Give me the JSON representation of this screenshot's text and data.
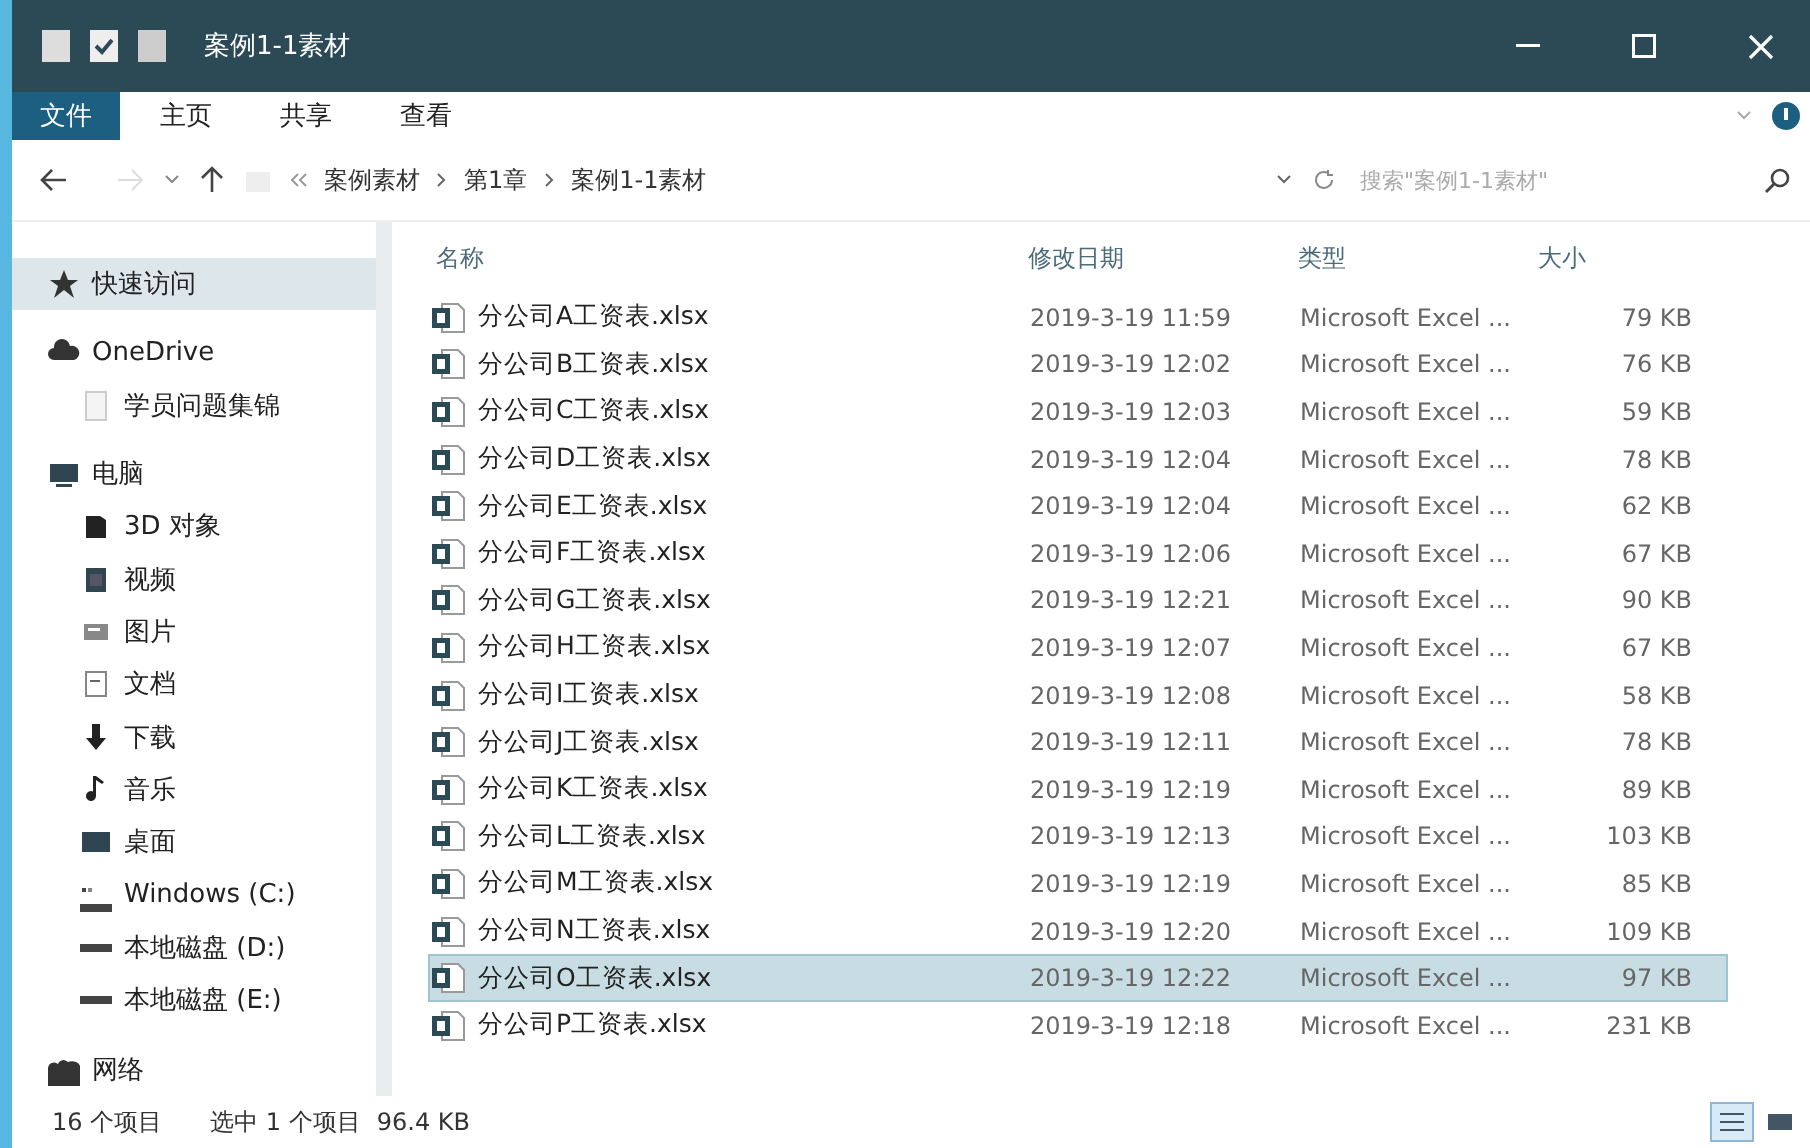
{
  "window": {
    "title": "案例1-1素材"
  },
  "ribbon_tabs": [
    {
      "label": "文件",
      "kind": "file"
    },
    {
      "label": "主页",
      "kind": "tab"
    },
    {
      "label": "共享",
      "kind": "tab"
    },
    {
      "label": "查看",
      "kind": "tab"
    }
  ],
  "breadcrumb": [
    "案例素材",
    "第1章",
    "案例1-1素材"
  ],
  "search": {
    "placeholder": "搜索\"案例1-1素材\""
  },
  "sidebar": {
    "items": [
      {
        "label": "快速访问",
        "selected": true
      },
      {
        "label": "OneDrive",
        "selected": false,
        "children": [
          {
            "label": "学员问题集锦",
            "selected": false
          }
        ]
      },
      {
        "label": "电脑",
        "selected": false,
        "children": [
          {
            "label": "3D 对象",
            "selected": false
          },
          {
            "label": "视频",
            "selected": false
          },
          {
            "label": "图片",
            "selected": false
          },
          {
            "label": "文档",
            "selected": false
          },
          {
            "label": "下载",
            "selected": false
          },
          {
            "label": "音乐",
            "selected": false
          },
          {
            "label": "桌面",
            "selected": false
          },
          {
            "label": "Windows (C:)",
            "selected": false
          },
          {
            "label": "本地磁盘 (D:)",
            "selected": false
          },
          {
            "label": "本地磁盘 (E:)",
            "selected": false
          }
        ]
      },
      {
        "label": "网络",
        "selected": false
      }
    ]
  },
  "table": {
    "columns": [
      "名称",
      "修改日期",
      "类型",
      "大小"
    ],
    "rows": [
      {
        "name": "分公司A工资表.xlsx",
        "date": "2019-3-19 11:59",
        "type": "Microsoft Excel ...",
        "size": "79 KB",
        "selected": false
      },
      {
        "name": "分公司B工资表.xlsx",
        "date": "2019-3-19 12:02",
        "type": "Microsoft Excel ...",
        "size": "76 KB",
        "selected": false
      },
      {
        "name": "分公司C工资表.xlsx",
        "date": "2019-3-19 12:03",
        "type": "Microsoft Excel ...",
        "size": "59 KB",
        "selected": false
      },
      {
        "name": "分公司D工资表.xlsx",
        "date": "2019-3-19 12:04",
        "type": "Microsoft Excel ...",
        "size": "78 KB",
        "selected": false
      },
      {
        "name": "分公司E工资表.xlsx",
        "date": "2019-3-19 12:04",
        "type": "Microsoft Excel ...",
        "size": "62 KB",
        "selected": false
      },
      {
        "name": "分公司F工资表.xlsx",
        "date": "2019-3-19 12:06",
        "type": "Microsoft Excel ...",
        "size": "67 KB",
        "selected": false
      },
      {
        "name": "分公司G工资表.xlsx",
        "date": "2019-3-19 12:21",
        "type": "Microsoft Excel ...",
        "size": "90 KB",
        "selected": false
      },
      {
        "name": "分公司H工资表.xlsx",
        "date": "2019-3-19 12:07",
        "type": "Microsoft Excel ...",
        "size": "67 KB",
        "selected": false
      },
      {
        "name": "分公司I工资表.xlsx",
        "date": "2019-3-19 12:08",
        "type": "Microsoft Excel ...",
        "size": "58 KB",
        "selected": false
      },
      {
        "name": "分公司J工资表.xlsx",
        "date": "2019-3-19 12:11",
        "type": "Microsoft Excel ...",
        "size": "78 KB",
        "selected": false
      },
      {
        "name": "分公司K工资表.xlsx",
        "date": "2019-3-19 12:19",
        "type": "Microsoft Excel ...",
        "size": "89 KB",
        "selected": false
      },
      {
        "name": "分公司L工资表.xlsx",
        "date": "2019-3-19 12:13",
        "type": "Microsoft Excel ...",
        "size": "103 KB",
        "selected": false
      },
      {
        "name": "分公司M工资表.xlsx",
        "date": "2019-3-19 12:19",
        "type": "Microsoft Excel ...",
        "size": "85 KB",
        "selected": false
      },
      {
        "name": "分公司N工资表.xlsx",
        "date": "2019-3-19 12:20",
        "type": "Microsoft Excel ...",
        "size": "109 KB",
        "selected": false
      },
      {
        "name": "分公司O工资表.xlsx",
        "date": "2019-3-19 12:22",
        "type": "Microsoft Excel ...",
        "size": "97 KB",
        "selected": true
      },
      {
        "name": "分公司P工资表.xlsx",
        "date": "2019-3-19 12:18",
        "type": "Microsoft Excel ...",
        "size": "231 KB",
        "selected": false
      }
    ]
  },
  "status_bar": {
    "item_count": "16 个项目",
    "selection": "选中 1 个项目",
    "selection_size": "96.4 KB",
    "views": [
      {
        "kind": "details",
        "selected": true
      },
      {
        "kind": "large_icons",
        "selected": false
      }
    ]
  }
}
